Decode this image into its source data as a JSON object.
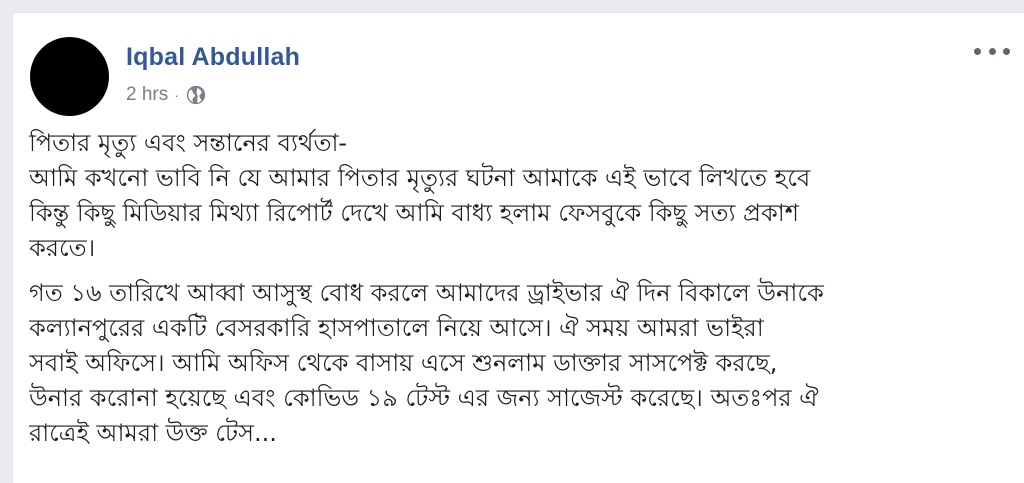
{
  "post": {
    "author": "Iqbal Abdullah",
    "time": "2 hrs",
    "separator": "·",
    "privacy_icon": "globe-icon",
    "more_icon": "more-options-icon",
    "paragraphs": [
      {
        "lines": [
          "পিতার মৃত্যু এবং সন্তানের ব্যর্থতা-",
          "আমি কখনো ভাবি নি যে আমার পিতার মৃত্যুর ঘটনা আমাকে এই ভাবে লিখতে হবে",
          "কিন্তু কিছু মিডিয়ার মিথ্যা রিপোর্ট দেখে আমি বাধ্য হলাম ফেসবুকে কিছু সত্য প্রকাশ",
          "করতে।"
        ]
      },
      {
        "lines": [
          "গত ১৬ তারিখে আব্বা আসুস্থ বোধ করলে আমাদের ড্রাইভার ঐ দিন বিকালে উনাকে",
          "কল্যানপুরের একটি বেসরকারি হাসপাতালে নিয়ে আসে। ঐ সময় আমরা ভাইরা",
          "সবাই অফিসে। আমি অফিস থেকে বাসায় এসে শুনলাম ডাক্তার সাসপেক্ট করছে,",
          "উনার করোনা হয়েছে এবং কোভিড ১৯ টেস্ট এর জন্য সাজেস্ট করেছে। অতঃপর ঐ",
          "রাত্রেই আমরা উক্ত টেস..."
        ]
      }
    ]
  },
  "colors": {
    "author": "#365899",
    "meta": "#7a7f87",
    "text": "#1c1e21",
    "background": "#e9ebee",
    "card": "#ffffff"
  }
}
